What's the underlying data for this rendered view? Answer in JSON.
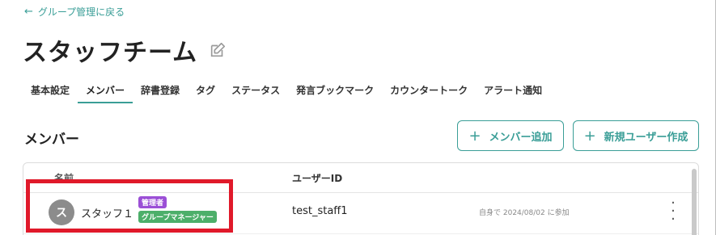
{
  "back_link": {
    "label": "グループ管理に戻る",
    "icon": "arrow-left-icon"
  },
  "page_title": "スタッフチーム",
  "tabs": [
    {
      "label": "基本設定",
      "active": false
    },
    {
      "label": "メンバー",
      "active": true
    },
    {
      "label": "辞書登録",
      "active": false
    },
    {
      "label": "タグ",
      "active": false
    },
    {
      "label": "ステータス",
      "active": false
    },
    {
      "label": "発言ブックマーク",
      "active": false
    },
    {
      "label": "カウンタートーク",
      "active": false
    },
    {
      "label": "アラート通知",
      "active": false
    }
  ],
  "section_title": "メンバー",
  "buttons": {
    "add_member": "メンバー追加",
    "new_user": "新規ユーザー作成"
  },
  "table": {
    "headers": {
      "name": "名前",
      "user_id": "ユーザーID"
    },
    "rows": [
      {
        "avatar": "ス",
        "name": "スタッフ１",
        "badges": [
          "管理者",
          "グループマネージャー"
        ],
        "user_id": "test_staff1",
        "joined": "自身で 2024/08/02 に参加"
      }
    ]
  },
  "colors": {
    "accent": "#3a9e97",
    "admin_badge": "#9b4fd6",
    "group_badge": "#4caf6a",
    "highlight": "#e0192a"
  }
}
